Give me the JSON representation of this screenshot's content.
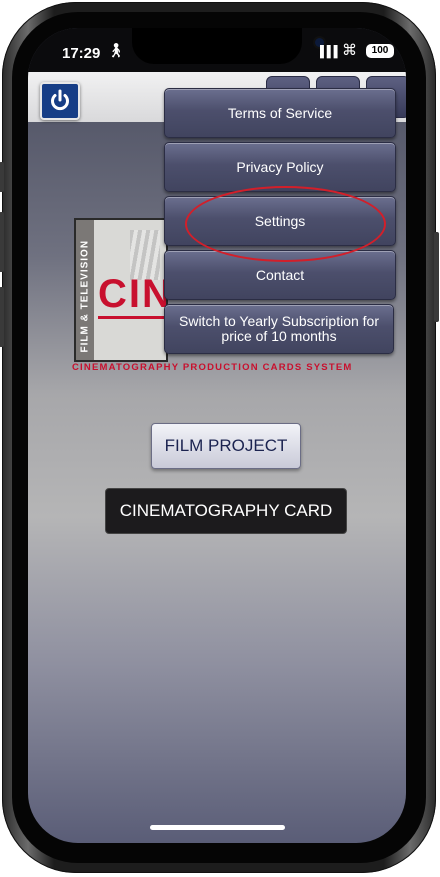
{
  "status_bar": {
    "time": "17:29",
    "activity_icon": "walking-person-icon",
    "battery": "100"
  },
  "app_bar": {
    "power_icon": "power-icon",
    "icons": [
      "settings-icon",
      "wifi-cloud-icon",
      "menu-icon"
    ]
  },
  "logo": {
    "side_text": "FILM & TELEVISION",
    "word": "CIN",
    "tagline": "CINEMATOGRAPHY PRODUCTION CARDS SYSTEM"
  },
  "menu": {
    "items": [
      {
        "label": "Terms of Service"
      },
      {
        "label": "Privacy Policy"
      },
      {
        "label": "Settings",
        "highlighted": true
      },
      {
        "label": "Contact"
      },
      {
        "label": "Switch to Yearly Subscription for price of 10 months"
      }
    ]
  },
  "buttons": {
    "film_project": "FILM PROJECT",
    "cinematography_card": "CINEMATOGRAPHY CARD"
  },
  "colors": {
    "menu_bg": "#4c4f6c",
    "brand_red": "#c8102e",
    "power_blue": "#173e86",
    "highlight": "#d21f2a"
  }
}
